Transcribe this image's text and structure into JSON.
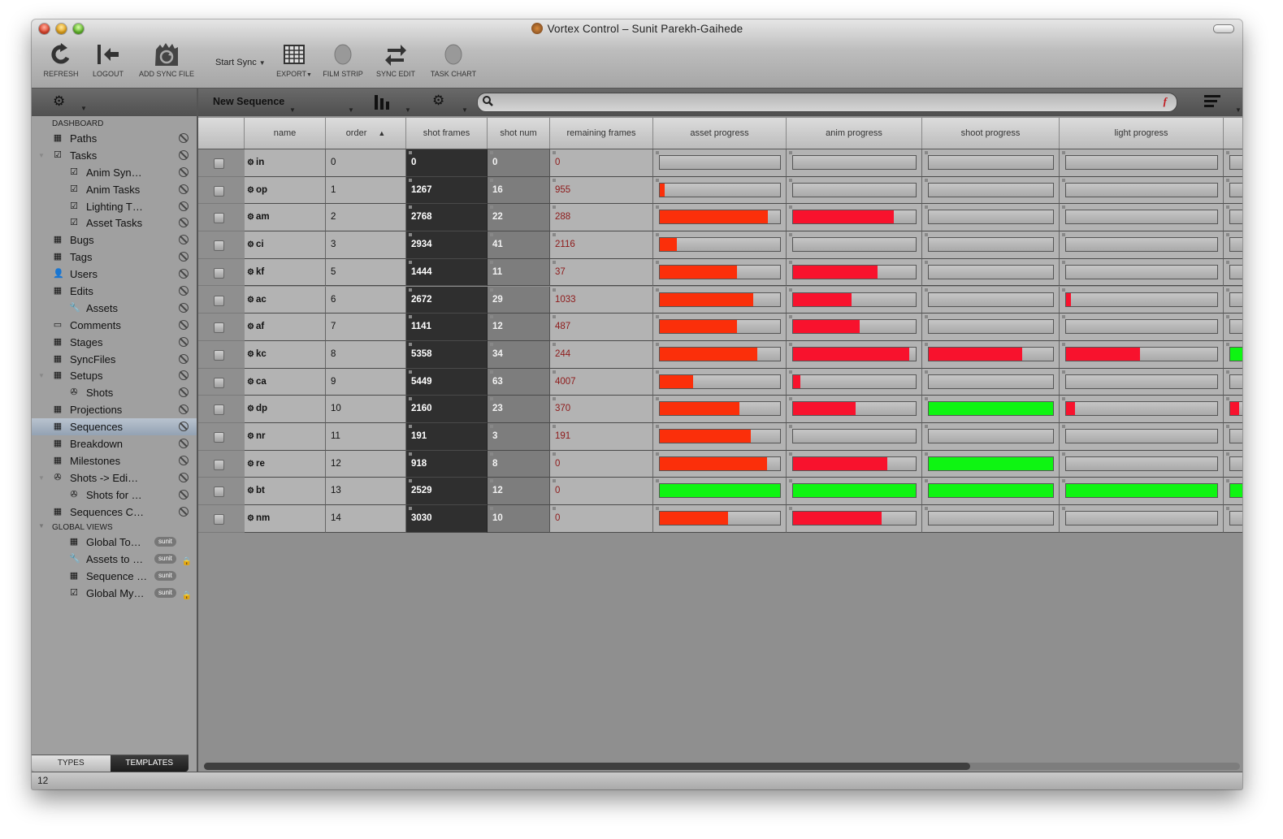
{
  "window": {
    "title": "Vortex Control – Sunit Parekh-Gaihede"
  },
  "toolbar": {
    "refresh": "REFRESH",
    "logout": "LOGOUT",
    "add_sync_file": "ADD SYNC FILE",
    "start_sync": "Start Sync",
    "export": "EXPORT",
    "film_strip": "FILM STRIP",
    "sync_edit": "SYNC EDIT",
    "task_chart": "TASK CHART"
  },
  "sidebar": {
    "dashboard_header": "DASHBOARD",
    "global_header": "GLOBAL VIEWS",
    "items": [
      {
        "label": "Paths",
        "icon": "grid-doc-icon"
      },
      {
        "label": "Tasks",
        "icon": "checkbox-icon"
      },
      {
        "label": "Anim Syn…",
        "icon": "checkbox-icon"
      },
      {
        "label": "Anim Tasks",
        "icon": "checkbox-icon"
      },
      {
        "label": "Lighting T…",
        "icon": "checkbox-icon"
      },
      {
        "label": "Asset Tasks",
        "icon": "checkbox-icon"
      },
      {
        "label": "Bugs",
        "icon": "grid-doc-icon"
      },
      {
        "label": "Tags",
        "icon": "grid-doc-icon"
      },
      {
        "label": "Users",
        "icon": "user-icon"
      },
      {
        "label": "Edits",
        "icon": "grid-doc-icon"
      },
      {
        "label": "Assets",
        "icon": "wrench-icon"
      },
      {
        "label": "Comments",
        "icon": "comment-icon"
      },
      {
        "label": "Stages",
        "icon": "grid-doc-icon"
      },
      {
        "label": "SyncFiles",
        "icon": "grid-doc-icon"
      },
      {
        "label": "Setups",
        "icon": "grid-doc-icon"
      },
      {
        "label": "Shots",
        "icon": "film-reel-icon"
      },
      {
        "label": "Projections",
        "icon": "grid-doc-icon"
      },
      {
        "label": "Sequences",
        "icon": "table-icon"
      },
      {
        "label": "Breakdown",
        "icon": "grid-doc-icon"
      },
      {
        "label": "Milestones",
        "icon": "grid-doc-icon"
      },
      {
        "label": "Shots -> Edi…",
        "icon": "film-reel-icon"
      },
      {
        "label": "Shots for …",
        "icon": "film-reel-icon"
      },
      {
        "label": "Sequences C…",
        "icon": "table-icon"
      }
    ],
    "global_items": [
      {
        "label": "Global To…",
        "badge": "sunit",
        "icon": "grid-doc-icon"
      },
      {
        "label": "Assets to …",
        "badge": "sunit",
        "icon": "wrench-icon"
      },
      {
        "label": "Sequence …",
        "badge": "sunit",
        "icon": "table-icon"
      },
      {
        "label": "Global My…",
        "badge": "sunit",
        "icon": "checkbox-icon"
      }
    ],
    "tab_types": "TYPES",
    "tab_templates": "TEMPLATES"
  },
  "main": {
    "sequence_name": "New Sequence",
    "search_placeholder": "",
    "columns": [
      "name",
      "order",
      "shot frames",
      "shot num",
      "remaining frames",
      "asset progress",
      "anim progress",
      "shoot progress",
      "light progress"
    ],
    "rows": [
      {
        "name": "in",
        "order": "0",
        "shot_frames": "0",
        "shot_num": "0",
        "remaining": "0",
        "asset": 0,
        "anim": 0,
        "shoot": 0,
        "light": 0,
        "extra": 0
      },
      {
        "name": "op",
        "order": "1",
        "shot_frames": "1267",
        "shot_num": "16",
        "remaining": "955",
        "asset": 0.04,
        "anim": 0,
        "shoot": 0,
        "light": 0,
        "extra": 0
      },
      {
        "name": "am",
        "order": "2",
        "shot_frames": "2768",
        "shot_num": "22",
        "remaining": "288",
        "asset": 0.9,
        "anim": 0.82,
        "shoot": 0,
        "light": 0,
        "extra": 0
      },
      {
        "name": "ci",
        "order": "3",
        "shot_frames": "2934",
        "shot_num": "41",
        "remaining": "2116",
        "asset": 0.14,
        "anim": 0,
        "shoot": 0,
        "light": 0,
        "extra": 0
      },
      {
        "name": "kf",
        "order": "5",
        "shot_frames": "1444",
        "shot_num": "11",
        "remaining": "37",
        "asset": 0.64,
        "anim": 0.69,
        "shoot": 0,
        "light": 0,
        "extra": 0
      },
      {
        "name": "ac",
        "order": "6",
        "shot_frames": "2672",
        "shot_num": "29",
        "remaining": "1033",
        "asset": 0.78,
        "anim": 0.48,
        "shoot": 0,
        "light": 0.03,
        "extra": 0
      },
      {
        "name": "af",
        "order": "7",
        "shot_frames": "1141",
        "shot_num": "12",
        "remaining": "487",
        "asset": 0.64,
        "anim": 0.54,
        "shoot": 0,
        "light": 0,
        "extra": 0
      },
      {
        "name": "kc",
        "order": "8",
        "shot_frames": "5358",
        "shot_num": "34",
        "remaining": "244",
        "asset": 0.81,
        "anim": 0.95,
        "shoot": 0.75,
        "light": 0.49,
        "extra": 1
      },
      {
        "name": "ca",
        "order": "9",
        "shot_frames": "5449",
        "shot_num": "63",
        "remaining": "4007",
        "asset": 0.28,
        "anim": 0.06,
        "shoot": 0,
        "light": 0,
        "extra": 0
      },
      {
        "name": "dp",
        "order": "10",
        "shot_frames": "2160",
        "shot_num": "23",
        "remaining": "370",
        "asset": 0.66,
        "anim": 0.51,
        "shoot": 1,
        "light": 0.06,
        "extra": 0.3
      },
      {
        "name": "nr",
        "order": "11",
        "shot_frames": "191",
        "shot_num": "3",
        "remaining": "191",
        "asset": 0.76,
        "anim": 0,
        "shoot": 0,
        "light": 0,
        "extra": 0
      },
      {
        "name": "re",
        "order": "12",
        "shot_frames": "918",
        "shot_num": "8",
        "remaining": "0",
        "asset": 0.89,
        "anim": 0.77,
        "shoot": 1,
        "light": 0,
        "extra": 0
      },
      {
        "name": "bt",
        "order": "13",
        "shot_frames": "2529",
        "shot_num": "12",
        "remaining": "0",
        "asset": 1,
        "anim": 1,
        "shoot": 1,
        "light": 1,
        "extra": 1
      },
      {
        "name": "nm",
        "order": "14",
        "shot_frames": "3030",
        "shot_num": "10",
        "remaining": "0",
        "asset": 0.57,
        "anim": 0.72,
        "shoot": 0,
        "light": 0,
        "extra": 0
      }
    ]
  },
  "colors": {
    "red": "#fb2f0a",
    "magenta_red": "#f8122d",
    "green": "#0ef512"
  },
  "status": {
    "count": "12"
  }
}
